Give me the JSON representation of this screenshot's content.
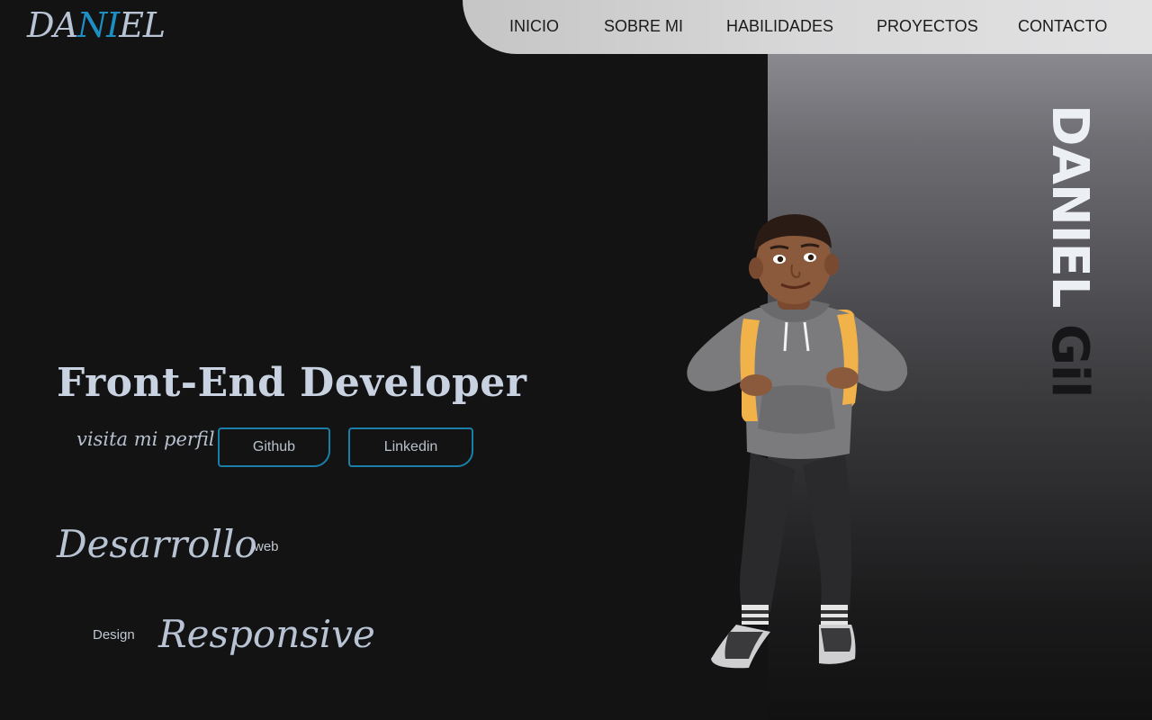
{
  "logo": {
    "part1": "DA",
    "part2": "NI",
    "part3": "EL"
  },
  "nav": {
    "items": [
      {
        "label": "INICIO"
      },
      {
        "label": "SOBRE MI"
      },
      {
        "label": "HABILIDADES"
      },
      {
        "label": "PROYECTOS"
      },
      {
        "label": "CONTACTO"
      }
    ]
  },
  "hero": {
    "title": "Front-End Developer",
    "visit_label": "visita mi perfil",
    "github_label": "Github",
    "linkedin_label": "Linkedin",
    "word1": "Desarrollo",
    "word2": "web",
    "word3": "Design",
    "word4": "Responsive"
  },
  "side_name": {
    "light": "DANIEL ",
    "dark": "Gil"
  },
  "icons": {
    "figure": "3d-character-illustration"
  },
  "colors": {
    "accent": "#1e8fc2",
    "background": "#131314",
    "text": "#b8c4d4",
    "nav_bg": "#d8d8d9"
  }
}
